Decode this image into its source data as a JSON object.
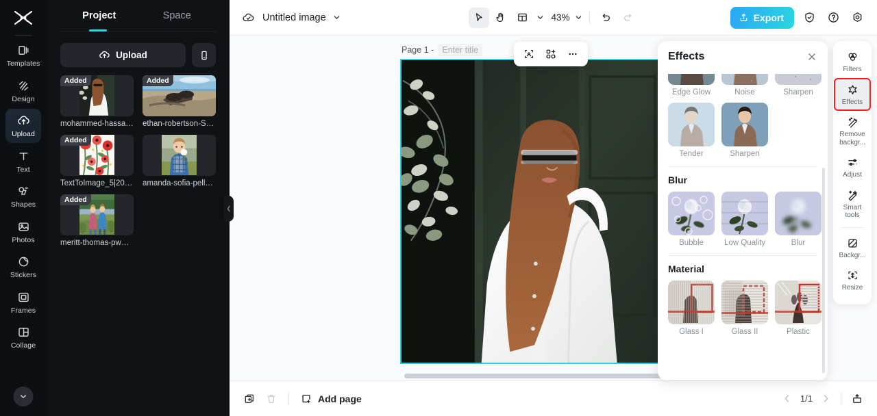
{
  "rail": {
    "logo_icon": "capcut-logo-icon",
    "items": [
      {
        "label": "Templates",
        "icon": "templates-icon",
        "active": false
      },
      {
        "label": "Design",
        "icon": "design-icon",
        "active": false
      },
      {
        "label": "Upload",
        "icon": "upload-cloud-icon",
        "active": true
      },
      {
        "label": "Text",
        "icon": "text-icon",
        "active": false
      },
      {
        "label": "Shapes",
        "icon": "shapes-icon",
        "active": false
      },
      {
        "label": "Photos",
        "icon": "photos-icon",
        "active": false
      },
      {
        "label": "Stickers",
        "icon": "stickers-icon",
        "active": false
      },
      {
        "label": "Frames",
        "icon": "frames-icon",
        "active": false
      },
      {
        "label": "Collage",
        "icon": "collage-icon",
        "active": false
      }
    ],
    "more_icon": "chevron-down-icon"
  },
  "panel": {
    "tabs": [
      {
        "label": "Project",
        "active": true
      },
      {
        "label": "Space",
        "active": false
      }
    ],
    "upload_label": "Upload",
    "upload_icon": "upload-cloud-icon",
    "phone_icon": "mobile-phone-icon",
    "badge_label": "Added",
    "assets": [
      {
        "name": "mohammed-hassan-...",
        "badge": "Added",
        "kind": "woman-door"
      },
      {
        "name": "ethan-robertson-SYx...",
        "badge": "Added",
        "kind": "sunglasses-beach"
      },
      {
        "name": "TextToImage_5|2023...",
        "badge": "Added",
        "kind": "poppy-flowers"
      },
      {
        "name": "amanda-sofia-pellen...",
        "badge": "",
        "kind": "boy-dandelion"
      },
      {
        "name": "meritt-thomas-pwCJ...",
        "badge": "Added",
        "kind": "kids-lake"
      }
    ]
  },
  "handle_icon": "chevron-left-icon",
  "topbar": {
    "cloud_icon": "cloud-check-icon",
    "doc_title": "Untitled image",
    "title_caret_icon": "chevron-down-icon",
    "tools": [
      {
        "icon": "cursor-select-icon",
        "name": "select-tool",
        "active": true
      },
      {
        "icon": "hand-pan-icon",
        "name": "hand-tool",
        "active": false
      },
      {
        "icon": "layout-grid-icon",
        "name": "layout-tool",
        "active": false
      }
    ],
    "layout_caret_icon": "chevron-down-icon",
    "zoom_value": "43%",
    "zoom_caret_icon": "chevron-down-icon",
    "undo_icon": "undo-icon",
    "redo_icon": "redo-icon",
    "export_label": "Export",
    "export_icon": "export-share-icon",
    "export_color": "#2aa7f5",
    "shield_icon": "shield-check-icon",
    "help_icon": "question-circle-icon",
    "settings_icon": "gear-icon"
  },
  "canvas": {
    "page_label": "Page 1 -",
    "title_placeholder": "Enter title",
    "float_tools": [
      {
        "icon": "crop-smart-icon",
        "name": "smart-crop-button"
      },
      {
        "icon": "qr-layers-icon",
        "name": "layers-button"
      },
      {
        "icon": "more-dots-icon",
        "name": "more-options-button"
      }
    ],
    "selection_color": "#25d3e4"
  },
  "bottombar": {
    "duplicate_icon": "duplicate-page-icon",
    "delete_icon": "trash-icon",
    "add_page_label": "Add page",
    "add_page_icon": "add-page-icon",
    "prev_icon": "chevron-left-icon",
    "page_indicator": "1/1",
    "next_icon": "chevron-right-icon",
    "upload_icon": "upload-tray-icon"
  },
  "effects_panel": {
    "title": "Effects",
    "close_icon": "close-icon",
    "top_row": [
      {
        "label": "Edge Glow",
        "art": "man-brown"
      },
      {
        "label": "Noise",
        "art": "man-noise"
      },
      {
        "label": "Sharpen",
        "art": "man-rainbow"
      }
    ],
    "second_row": [
      {
        "label": "Tender",
        "art": "man-tender"
      },
      {
        "label": "Sharpen",
        "art": "man-sharp"
      }
    ],
    "sections": [
      {
        "title": "Blur",
        "items": [
          {
            "label": "Bubble",
            "art": "rose-bubble"
          },
          {
            "label": "Low Quality",
            "art": "rose-lowq"
          },
          {
            "label": "Blur",
            "art": "rose-blur"
          }
        ]
      },
      {
        "title": "Material",
        "items": [
          {
            "label": "Glass I",
            "art": "glass-one"
          },
          {
            "label": "Glass II",
            "art": "glass-two"
          },
          {
            "label": "Plastic",
            "art": "plastic"
          }
        ]
      }
    ]
  },
  "right_rail": {
    "highlight_color": "#ff1f1f",
    "items": [
      {
        "label": "Filters",
        "icon": "filters-circles-icon",
        "selected": false,
        "highlight": false
      },
      {
        "label": "Effects",
        "icon": "effects-star-icon",
        "selected": true,
        "highlight": true
      },
      {
        "label": "Remove backgr...",
        "icon": "remove-background-icon",
        "selected": false,
        "highlight": false
      },
      {
        "label": "Adjust",
        "icon": "adjust-sliders-icon",
        "selected": false,
        "highlight": false
      },
      {
        "label": "Smart tools",
        "icon": "smart-tools-wand-icon",
        "selected": false,
        "highlight": false
      },
      {
        "label": "Backgr...",
        "icon": "background-pattern-icon",
        "selected": false,
        "highlight": false
      },
      {
        "label": "Resize",
        "icon": "resize-icon",
        "selected": false,
        "highlight": false
      }
    ]
  }
}
